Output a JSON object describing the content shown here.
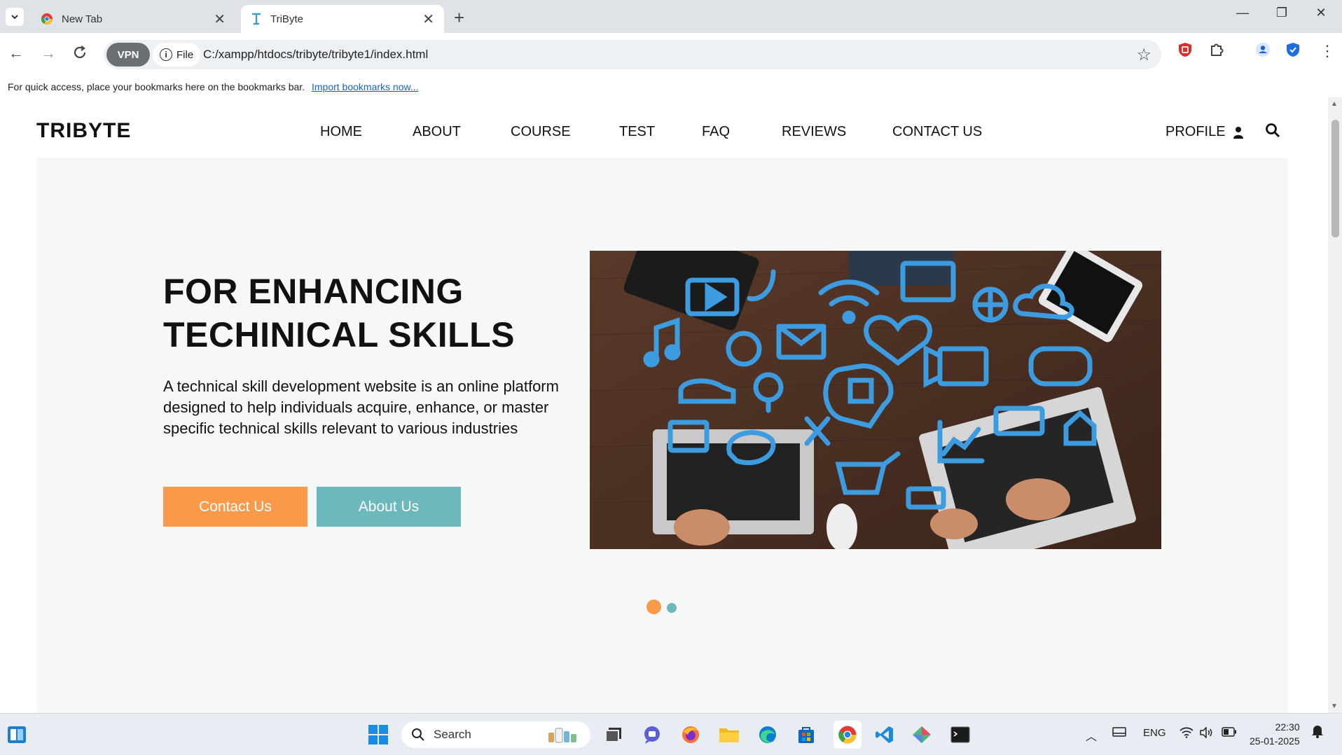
{
  "browser": {
    "tabs": [
      {
        "title": "New Tab",
        "active": false
      },
      {
        "title": "TriByte",
        "active": true
      }
    ],
    "vpn_label": "VPN",
    "file_chip": "File",
    "url": "C:/xampp/htdocs/tribyte/tribyte1/index.html",
    "bookmarks_hint": "For quick access, place your bookmarks here on the bookmarks bar.",
    "bookmarks_link": "Import bookmarks now..."
  },
  "site": {
    "brand": "TRIBYTE",
    "nav": [
      "HOME",
      "ABOUT",
      "COURSE",
      "TEST",
      "FAQ",
      "REVIEWS",
      "CONTACT US"
    ],
    "profile_label": "PROFILE",
    "hero": {
      "title_line1": "FOR ENHANCING",
      "title_line2": "TECHINICAL SKILLS",
      "text": "A technical skill development website is an online platform designed to help individuals acquire, enhance, or master specific technical skills relevant to various industries",
      "btn_contact": "Contact Us",
      "btn_about": "About Us",
      "slide_active": 1,
      "slide_count": 2
    },
    "colors": {
      "accent_orange": "#f9994a",
      "accent_teal": "#6db8bd",
      "hero_bg": "#f6f8f8"
    }
  },
  "taskbar": {
    "search_label": "Search",
    "lang": "ENG",
    "time": "22:30",
    "date": "25-01-2025"
  }
}
